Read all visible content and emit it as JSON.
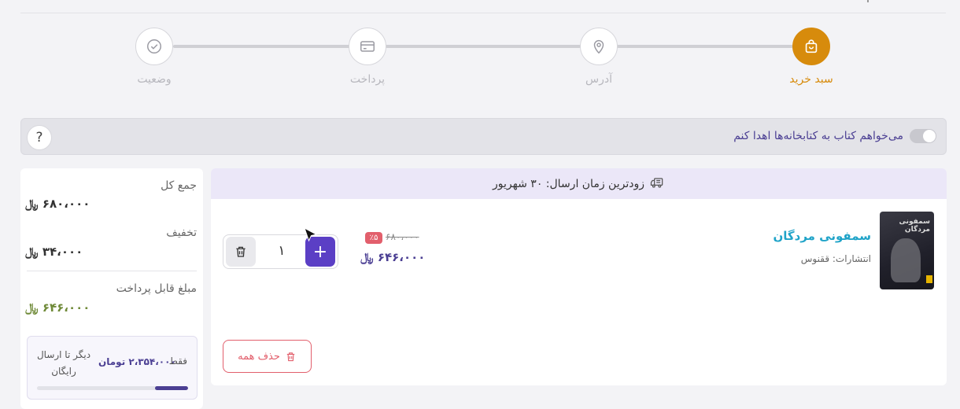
{
  "stepper": {
    "steps": [
      {
        "label": "سبد خرید",
        "icon": "shopping-bag-icon",
        "active": true
      },
      {
        "label": "آدرس",
        "icon": "location-pin-icon",
        "active": false
      },
      {
        "label": "پرداخت",
        "icon": "credit-card-icon",
        "active": false
      },
      {
        "label": "وضعیت",
        "icon": "check-circle-icon",
        "active": false
      }
    ]
  },
  "donate": {
    "label": "می‌خواهم کتاب به کتابخانه‌ها اهدا کنم",
    "help": "?"
  },
  "summary": {
    "total_label": "جمع کل",
    "total_value": "۶۸۰،۰۰۰ ﷼",
    "discount_label": "تخفیف",
    "discount_value": "۳۴،۰۰۰ ﷼",
    "payable_label": "مبلغ قابل پرداخت",
    "payable_value": "۶۴۶،۰۰۰ ﷼",
    "shipping_prefix": "فقط",
    "shipping_amount": "۲،۳۵۴،۰۰۰ تومان",
    "shipping_suffix": "دیگر تا ارسال رایگان",
    "shipping_progress": 0.22
  },
  "cart": {
    "header": "زودترین زمان ارسال: ۳۰ شهریور",
    "items": [
      {
        "title": "سمفونی مردگان",
        "cover_text": "سمفونی مردگان",
        "publisher": "انتشارات: ققنوس",
        "price_old": "۶۸۰،۰۰۰",
        "discount": "٪۵",
        "price_new": "۶۴۶،۰۰۰ ﷼",
        "quantity": "۱"
      }
    ],
    "delete_all_label": "حذف همه"
  },
  "colors": {
    "accent": "#d78b0c",
    "primary": "#5b3fc5",
    "danger": "#e25f6c",
    "link": "#1fa3c8"
  }
}
